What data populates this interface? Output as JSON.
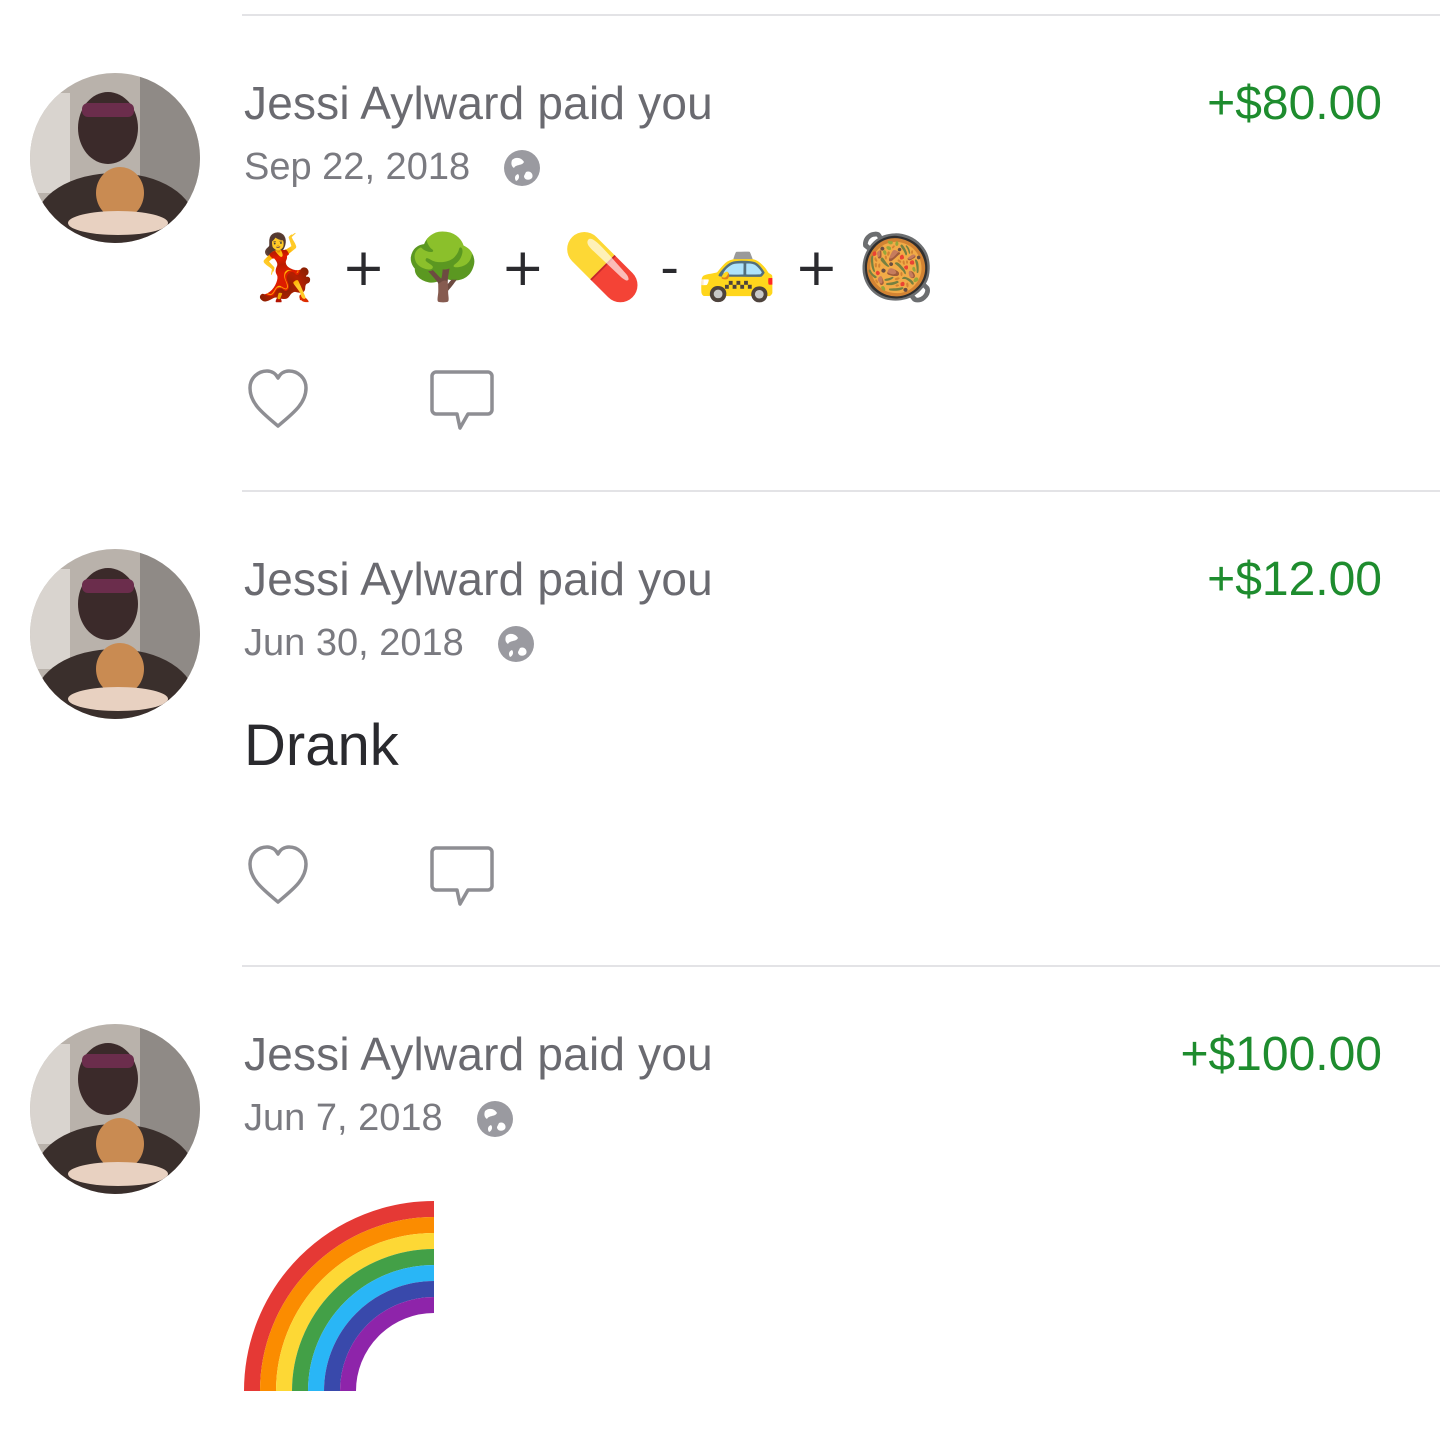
{
  "feed": {
    "items": [
      {
        "title": "Jessi Aylward paid you",
        "amount": "+$80.00",
        "date": "Sep 22, 2018",
        "visibility_icon": "globe-icon",
        "note": {
          "type": "emoji",
          "tokens": [
            {
              "kind": "emoji",
              "name": "dancer",
              "glyph": "💃"
            },
            {
              "kind": "op",
              "glyph": "+"
            },
            {
              "kind": "emoji",
              "name": "tree",
              "glyph": "🌳"
            },
            {
              "kind": "op",
              "glyph": "+"
            },
            {
              "kind": "emoji",
              "name": "pill",
              "glyph": "💊"
            },
            {
              "kind": "op",
              "glyph": "-"
            },
            {
              "kind": "emoji",
              "name": "taxi",
              "glyph": "🚕"
            },
            {
              "kind": "op",
              "glyph": "+"
            },
            {
              "kind": "emoji",
              "name": "paella",
              "glyph": "🥘"
            }
          ]
        },
        "like_icon": "heart-icon",
        "comment_icon": "comment-icon"
      },
      {
        "title": "Jessi Aylward paid you",
        "amount": "+$12.00",
        "date": "Jun 30, 2018",
        "visibility_icon": "globe-icon",
        "note": {
          "type": "text",
          "text": "Drank"
        },
        "like_icon": "heart-icon",
        "comment_icon": "comment-icon"
      },
      {
        "title": "Jessi Aylward paid you",
        "amount": "+$100.00",
        "date": "Jun 7, 2018",
        "visibility_icon": "globe-icon",
        "note": {
          "type": "emoji",
          "tokens": [
            {
              "kind": "emoji",
              "name": "rainbow",
              "glyph": "🌈"
            }
          ]
        },
        "like_icon": "heart-icon",
        "comment_icon": "comment-icon"
      }
    ]
  },
  "colors": {
    "amount_green": "#1e8c2e",
    "title_gray": "#6a6a70",
    "icon_gray": "#8e8e93",
    "divider": "#e3e3e6"
  }
}
